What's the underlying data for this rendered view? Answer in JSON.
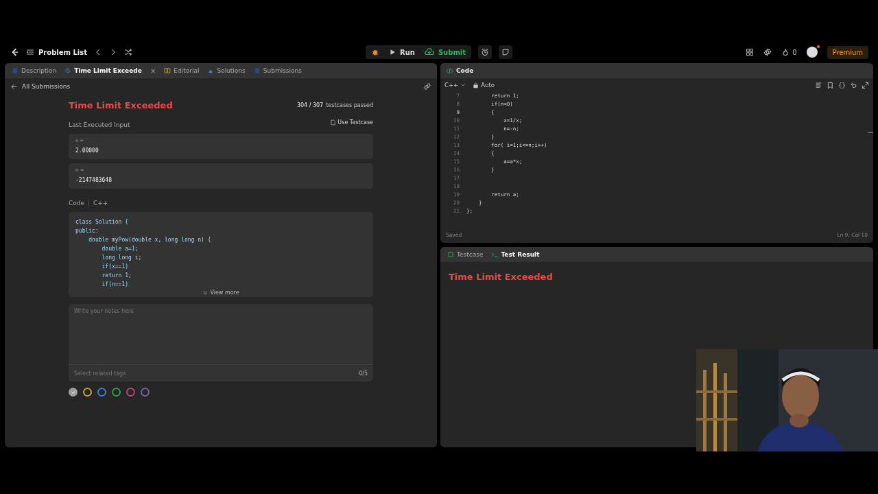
{
  "nav": {
    "problem_list": "Problem List",
    "run": "Run",
    "submit": "Submit",
    "streak": "0",
    "premium": "Premium"
  },
  "left_panel": {
    "tabs": [
      {
        "label": "Description",
        "selected": false
      },
      {
        "label": "Time Limit Exceede",
        "selected": true,
        "close": "×"
      },
      {
        "label": "Editorial",
        "selected": false
      },
      {
        "label": "Solutions",
        "selected": false
      },
      {
        "label": "Submissions",
        "selected": false
      }
    ],
    "back_link": "All Submissions",
    "status": "Time Limit Exceeded",
    "passed_count": "304 / 307",
    "passed_label": "testcases passed",
    "input_heading": "Last Executed Input",
    "use_testcase": "Use Testcase",
    "inputs": [
      {
        "name": "x =",
        "value": "2.00000"
      },
      {
        "name": "n =",
        "value": "-2147483648"
      }
    ],
    "code_label": "Code",
    "code_lang": "C++",
    "code_lines": [
      "class Solution {",
      "public:",
      "    double myPow(double x, long long n) {",
      "        double a=1;",
      "        long long i;",
      "        if(x==1)",
      "        return 1;",
      "        if(n==1)"
    ],
    "view_more": "View more",
    "notes": {
      "placeholder": "Write your notes here"
    },
    "tags": {
      "placeholder": "Select related tags",
      "count": "0/5"
    },
    "colors": [
      {
        "color": "#9e9e9e",
        "selected": true
      },
      {
        "color": "#c9a227",
        "selected": false
      },
      {
        "color": "#3b7dd8",
        "selected": false
      },
      {
        "color": "#2e9e4f",
        "selected": false
      },
      {
        "color": "#b8456a",
        "selected": false
      },
      {
        "color": "#7d5fa0",
        "selected": false
      }
    ]
  },
  "code_panel": {
    "title": "Code",
    "language": "C++",
    "mode": "Auto",
    "lines": [
      {
        "number": "7",
        "text": "        return 1;",
        "current": false
      },
      {
        "number": "8",
        "text": "        if(n<0)",
        "current": false
      },
      {
        "number": "9",
        "text": "        {",
        "current": true
      },
      {
        "number": "10",
        "text": "            x=1/x;",
        "current": false
      },
      {
        "number": "11",
        "text": "            n=-n;",
        "current": false
      },
      {
        "number": "12",
        "text": "        }",
        "current": false
      },
      {
        "number": "13",
        "text": "        for( i=1;i<=n;i++)",
        "current": false
      },
      {
        "number": "14",
        "text": "        {",
        "current": false
      },
      {
        "number": "15",
        "text": "            a=a*x;",
        "current": false
      },
      {
        "number": "16",
        "text": "        }",
        "current": false
      },
      {
        "number": "17",
        "current": false
      },
      {
        "number": "18",
        "current": false
      },
      {
        "number": "19",
        "text": "        return a;",
        "current": false
      },
      {
        "number": "20",
        "text": "    }",
        "current": false
      },
      {
        "number": "21",
        "text": "};",
        "current": false
      }
    ],
    "status": "Saved",
    "cursor": "Ln 9, Col 10"
  },
  "result_panel": {
    "tabs": [
      {
        "label": "Testcase",
        "selected": false
      },
      {
        "label": "Test Result",
        "selected": true
      }
    ],
    "verdict": "Time Limit Exceeded"
  }
}
